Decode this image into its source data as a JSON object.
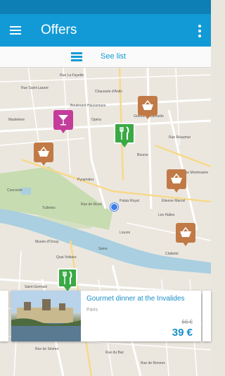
{
  "appbar": {
    "title": "Offers",
    "menu_icon": "hamburger-menu-icon",
    "overflow_icon": "overflow-dots-icon"
  },
  "toolbar": {
    "see_list_label": "See list",
    "list_icon": "list-view-icon"
  },
  "colors": {
    "appbar": "#129ad6",
    "statusbar": "#0d7fb4",
    "accent": "#1a8fc9",
    "pin_shopping": "#c17a46",
    "pin_bar": "#c43d9b",
    "pin_restaurant": "#3aa945"
  },
  "map": {
    "labels": {
      "l1": "Rue La Fayette",
      "l2": "Boulevard Haussmann",
      "l3": "Rue Saint-Lazare",
      "l4": "Chaussée d'Antin",
      "l5": "Opéra",
      "l6": "Madeleine",
      "l7": "Palais Royal",
      "l8": "Rue de Rivoli",
      "l9": "Louvre",
      "l10": "Les Halles",
      "l11": "Châtelet",
      "l12": "Rue Réaumur",
      "l13": "Musée d'Orsay",
      "l14": "Seine",
      "l15": "Saint-Germain",
      "l16": "Rue de Sèvres",
      "l17": "Rue du Bac",
      "l18": "Grands Boulevards",
      "l19": "Concorde",
      "l20": "Tuileries",
      "l21": "Pyramides",
      "l22": "Étienne Marcel",
      "l23": "Rue Montmartre",
      "l24": "Bourse",
      "l25": "Quai Voltaire",
      "l26": "Rue de Rennes"
    }
  },
  "pins": [
    {
      "type": "shopping",
      "icon": "shopping-basket-icon"
    },
    {
      "type": "bar",
      "icon": "cocktail-glass-icon"
    },
    {
      "type": "shopping",
      "icon": "shopping-basket-icon"
    },
    {
      "type": "restaurant",
      "icon": "fork-knife-icon"
    },
    {
      "type": "shopping",
      "icon": "shopping-basket-icon"
    },
    {
      "type": "shopping",
      "icon": "shopping-basket-icon"
    },
    {
      "type": "restaurant",
      "icon": "fork-knife-icon"
    }
  ],
  "offer_card": {
    "title": "Gourmet dinner at the Invalides",
    "city": "Paris",
    "old_price": "66 €",
    "price": "39 €"
  }
}
